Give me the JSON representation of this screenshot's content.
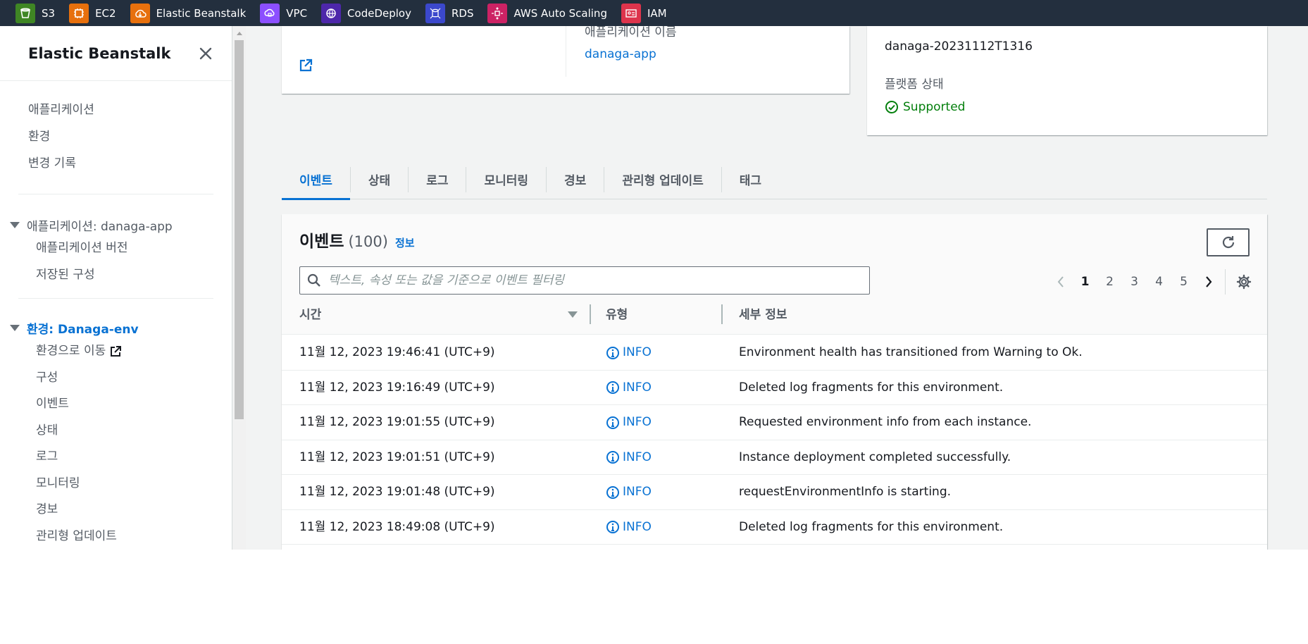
{
  "favorites": [
    {
      "label": "S3",
      "icon": "s3-icon",
      "color": "#3f8624"
    },
    {
      "label": "EC2",
      "icon": "ec2-icon",
      "color": "#e7700d"
    },
    {
      "label": "Elastic Beanstalk",
      "icon": "elastic-beanstalk-icon",
      "color": "#e7700d"
    },
    {
      "label": "VPC",
      "icon": "vpc-icon",
      "color": "#8c4fff"
    },
    {
      "label": "CodeDeploy",
      "icon": "codedeploy-icon",
      "color": "#4d27aa"
    },
    {
      "label": "RDS",
      "icon": "rds-icon",
      "color": "#3b48cc"
    },
    {
      "label": "AWS Auto Scaling",
      "icon": "auto-scaling-icon",
      "color": "#cc2264"
    },
    {
      "label": "IAM",
      "icon": "iam-icon",
      "color": "#dd344c"
    }
  ],
  "sidebar": {
    "title": "Elastic Beanstalk",
    "top_links": [
      "애플리케이션",
      "환경",
      "변경 기록"
    ],
    "app_group": {
      "label": "애플리케이션: danaga-app",
      "items": [
        "애플리케이션 버전",
        "저장된 구성"
      ]
    },
    "env_group": {
      "label": "환경: Danaga-env",
      "items": [
        "환경으로 이동",
        "구성",
        "이벤트",
        "상태",
        "로그",
        "모니터링",
        "경보",
        "관리형 업데이트"
      ]
    }
  },
  "overview": {
    "app_name_label": "애플리케이션 이름",
    "app_name": "danaga-app",
    "platform_version": "danaga-20231112T1316",
    "platform_status_label": "플랫폼 상태",
    "platform_status": "Supported"
  },
  "tabs": [
    "이벤트",
    "상태",
    "로그",
    "모니터링",
    "경보",
    "관리형 업데이트",
    "태그"
  ],
  "events": {
    "title": "이벤트",
    "count": "(100)",
    "info_link": "정보",
    "search_placeholder": "텍스트, 속성 또는 값을 기준으로 이벤트 필터링",
    "pages": [
      "1",
      "2",
      "3",
      "4",
      "5"
    ],
    "current_page": "1",
    "columns": [
      "시간",
      "유형",
      "세부 정보"
    ],
    "rows": [
      {
        "time": "11월 12, 2023 19:46:41 (UTC+9)",
        "type": "INFO",
        "detail": "Environment health has transitioned from Warning to Ok."
      },
      {
        "time": "11월 12, 2023 19:16:49 (UTC+9)",
        "type": "INFO",
        "detail": "Deleted log fragments for this environment."
      },
      {
        "time": "11월 12, 2023 19:01:55 (UTC+9)",
        "type": "INFO",
        "detail": "Requested environment info from each instance."
      },
      {
        "time": "11월 12, 2023 19:01:51 (UTC+9)",
        "type": "INFO",
        "detail": "Instance deployment completed successfully."
      },
      {
        "time": "11월 12, 2023 19:01:48 (UTC+9)",
        "type": "INFO",
        "detail": "requestEnvironmentInfo is starting."
      },
      {
        "time": "11월 12, 2023 18:49:08 (UTC+9)",
        "type": "INFO",
        "detail": "Deleted log fragments for this environment."
      }
    ]
  },
  "colors": {
    "accent": "#0972d3",
    "success": "#037f0c",
    "topbar": "#232f3e"
  }
}
